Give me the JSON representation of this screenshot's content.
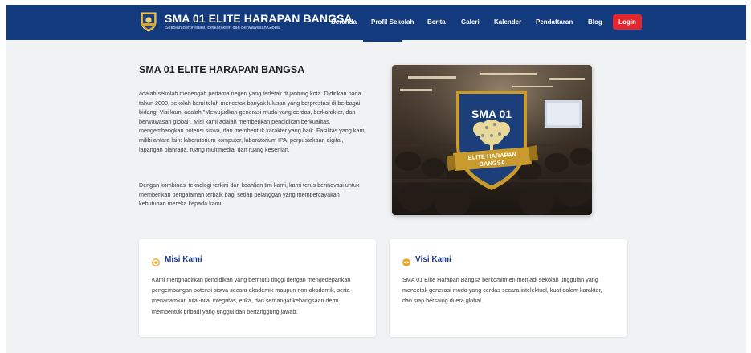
{
  "header": {
    "school_name": "SMA 01 ELITE HARAPAN BANGSA",
    "tagline": "Sekolah Berprestasi, Berkarakter, dan Berwawasan Global",
    "nav": [
      "Beranda",
      "Profil Sekolah",
      "Berita",
      "Galeri",
      "Kalender",
      "Pendaftaran",
      "Blog"
    ],
    "active_nav": "Profil Sekolah",
    "login_label": "Login"
  },
  "about": {
    "title": "SMA 01 ELITE HARAPAN BANGSA",
    "paragraph1": "adalah sekolah menengah pertama negeri yang terletak di jantung kota. Didirikan pada tahun 2000, sekolah kami telah mencetak banyak lulusan yang berprestasi di berbagai bidang. Visi kami adalah \"Mewujudkan generasi muda yang cerdas, berkarakter, dan berwawasan global\". Misi kami adalah memberikan pendidikan berkualitas, mengembangkan potensi siswa, dan membentuk karakter yang baik. Fasilitas yang kami miliki antara lain: laboratorium komputer, laboratorium IPA, perpustakaan digital, lapangan olahraga, ruang multimedia, dan ruang kesenian.",
    "paragraph2": "Dengan kombinasi teknologi terkini dan keahlian tim kami, kami terus berinovasi untuk memberikan pengalaman terbaik bagi setiap pelanggan yang mempercayakan kebutuhan mereka kepada kami.",
    "badge_top": "SMA 01",
    "badge_ribbon_line1": "ELITE HARAPAN",
    "badge_ribbon_line2": "BANGSA"
  },
  "misi": {
    "title": "Misi Kami",
    "text": "Kami menghadirkan pendidikan yang bermutu tinggi dengan mengedepankan pengembangan potensi siswa secara akademik maupun non-akademik, serta menanamkan nilai-nilai integritas, etika, dan semangat kebangsaan demi membentuk pribadi yang unggul dan bertanggung jawab."
  },
  "visi": {
    "title": "Visi Kami",
    "text": "SMA 01 Elite Harapan Bangsa berkomitmen menjadi sekolah unggulan yang mencetak generasi muda yang cerdas secara intelektual, kuat dalam karakter, dan siap bersaing di era global."
  },
  "colors": {
    "navbar": "#133a7c",
    "login": "#e4272e",
    "card_title": "#1a3c8c",
    "icon_accent": "#f0a21b"
  },
  "icons": {
    "logo": "school-crest-icon",
    "misi": "target-icon",
    "visi": "eye-icon"
  }
}
